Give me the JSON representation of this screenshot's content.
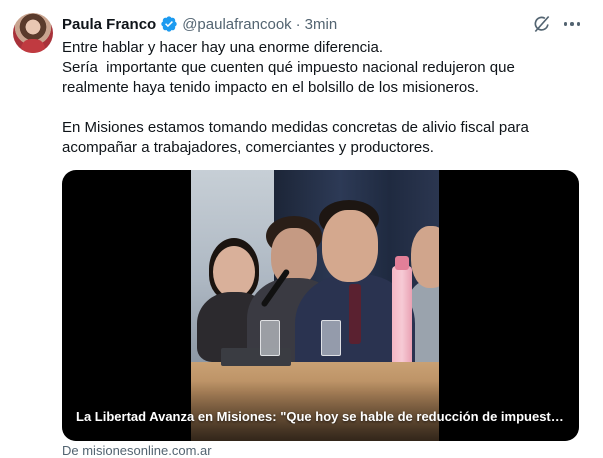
{
  "author": {
    "name": "Paula Franco",
    "handle": "@paulafrancook",
    "separator": "·",
    "time": "3min"
  },
  "tweet_text": {
    "line1": "Entre hablar y hacer hay una enorme diferencia.",
    "line2": "Sería  importante que cuenten qué impuesto nacional redujeron que",
    "line3": "realmente haya tenido impacto en el bolsillo de los misioneros.",
    "line4": "En Misiones estamos tomando medidas concretas de alivio fiscal para",
    "line5": "acompañar a trabajadores, comerciantes y productores."
  },
  "media": {
    "caption": "La Libertad Avanza en Misiones: \"Que hoy se hable de reducción de impuestos..."
  },
  "link_source": "De misionesonline.com.ar",
  "icons": {
    "verified": "verified-badge-icon",
    "grok": "grok-icon",
    "more": "more-icon"
  },
  "colors": {
    "verified_blue": "#1d9bf0",
    "secondary_text": "#536471",
    "primary_text": "#0f1419"
  }
}
